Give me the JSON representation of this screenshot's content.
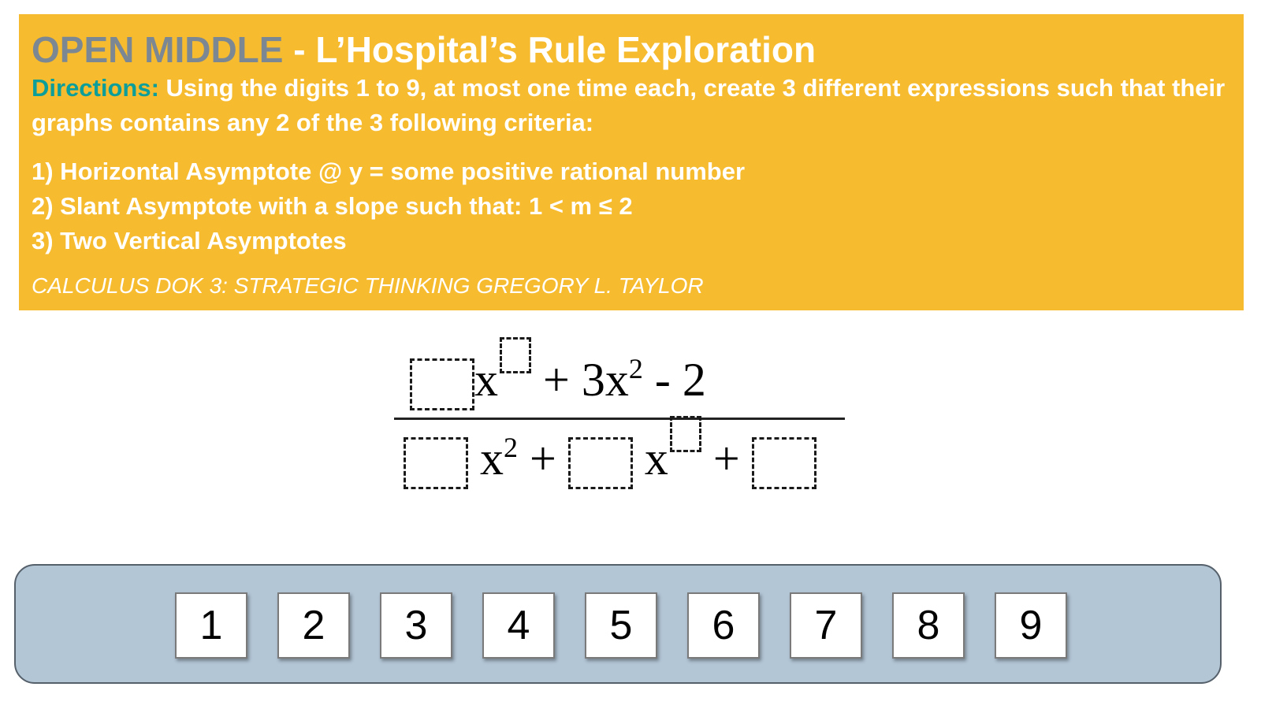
{
  "banner": {
    "title_prefix": "OPEN MIDDLE",
    "title_rest": " - L’Hospital’s Rule Exploration",
    "directions_label": "Directions:",
    "directions_text": " Using the digits 1 to 9, at most one time each, create 3 different expressions such that their graphs contains any 2 of the 3 following criteria:",
    "criteria": [
      "1) Horizontal Asymptote @ y = some positive rational number",
      "2) Slant Asymptote with a slope such that: 1 < m ≤ 2",
      "3) Two Vertical Asymptotes"
    ],
    "credit": "CALCULUS DOK 3: STRATEGIC THINKING GREGORY L. TAYLOR",
    "colors": {
      "background": "#f6bb2f",
      "open_middle": "#7b8793",
      "directions_label": "#0e9e9a"
    }
  },
  "expression": {
    "numerator": {
      "var1": "x",
      "term2": " + 3x",
      "term2_exp": "2",
      "term3": " - 2"
    },
    "denominator": {
      "var1": "x",
      "var1_exp": "2",
      "plus1": " + ",
      "var2": "x",
      "plus2": " + "
    }
  },
  "tray": {
    "digits": [
      "1",
      "2",
      "3",
      "4",
      "5",
      "6",
      "7",
      "8",
      "9"
    ],
    "colors": {
      "background": "#b3c6d6"
    }
  }
}
